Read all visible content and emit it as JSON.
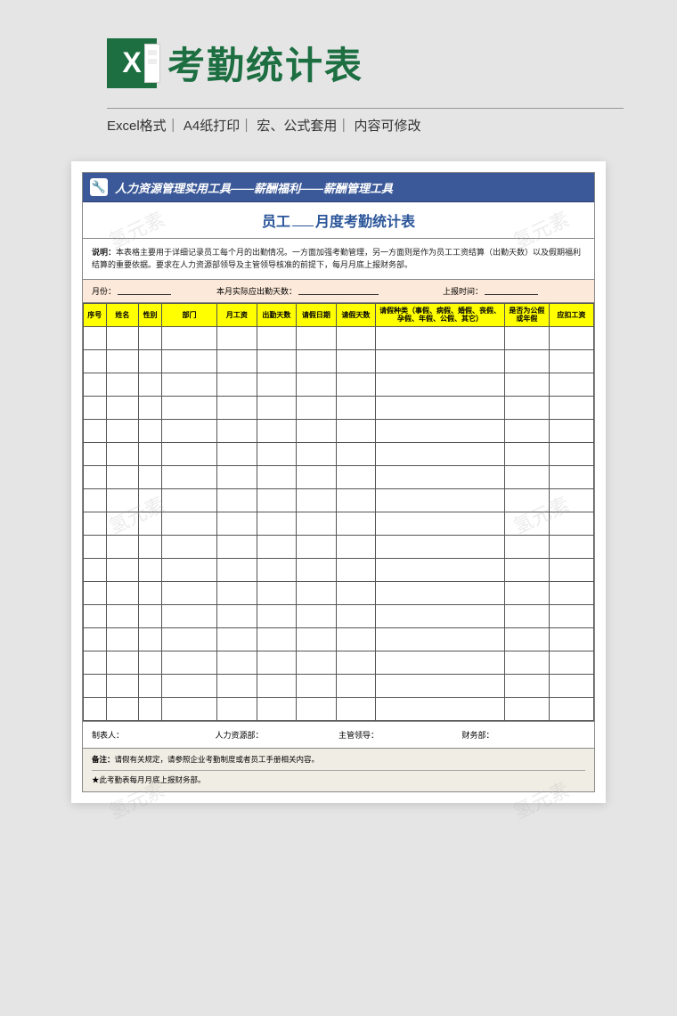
{
  "header": {
    "title": "考勤统计表",
    "subtitle": "Excel格式｜ A4纸打印｜ 宏、公式套用｜ 内容可修改"
  },
  "document": {
    "banner": "人力资源管理实用工具——薪酬福利——薪酬管理工具",
    "title_prefix": "员工",
    "title_suffix": "月度考勤统计表",
    "description_label": "说明：",
    "description": "本表格主要用于详细记录员工每个月的出勤情况。一方面加强考勤管理，另一方面则是作为员工工资结算（出勤天数）以及假期福利结算的重要依据。要求在人力资源部领导及主管领导核准的前提下，每月月底上报财务部。",
    "meta": {
      "month_label": "月份：",
      "actual_days_label": "本月实际应出勤天数：",
      "report_time_label": "上报时间："
    },
    "columns": [
      "序号",
      "姓名",
      "性别",
      "部门",
      "月工资",
      "出勤天数",
      "请假日期",
      "请假天数",
      "请假种类（事假、病假、婚假、丧假、孕假、年假、公假、其它）",
      "是否为公假或年假",
      "应扣工资"
    ],
    "col_widths": [
      "23",
      "33",
      "23",
      "56",
      "40",
      "40",
      "40",
      "40",
      "130",
      "45",
      "45"
    ],
    "row_count": 17,
    "signatures": {
      "maker": "制表人：",
      "hr": "人力资源部：",
      "supervisor": "主管领导：",
      "finance": "财务部："
    },
    "notes": {
      "label": "备注：",
      "line1": "请假有关规定，请参照企业考勤制度或者员工手册相关内容。",
      "line2": "★此考勤表每月月底上报财务部。"
    }
  },
  "watermark": "氢元素"
}
